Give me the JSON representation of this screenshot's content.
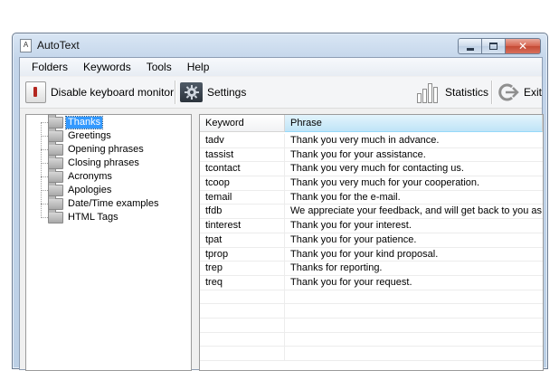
{
  "window": {
    "title": "AutoText",
    "icon_glyph": "A"
  },
  "caption_buttons": {
    "close_glyph": "✕"
  },
  "menu": [
    "Folders",
    "Keywords",
    "Tools",
    "Help"
  ],
  "toolbar": {
    "disable_monitor_label": "Disable keyboard monitor",
    "settings_label": "Settings",
    "statistics_label": "Statistics",
    "exit_label": "Exit"
  },
  "tree": {
    "selected": "Thanks",
    "folders": [
      "Thanks",
      "Greetings",
      "Opening phrases",
      "Closing phrases",
      "Acronyms",
      "Apologies",
      "Date/Time examples",
      "HTML Tags"
    ]
  },
  "list": {
    "columns": [
      "Keyword",
      "Phrase"
    ],
    "rows": [
      [
        "tadv",
        "Thank you very much in advance."
      ],
      [
        "tassist",
        "Thank you for your assistance."
      ],
      [
        "tcontact",
        "Thank you very much for contacting us."
      ],
      [
        "tcoop",
        "Thank you very much for your cooperation."
      ],
      [
        "temail",
        "Thank you for the e-mail."
      ],
      [
        "tfdb",
        "We appreciate your feedback, and will get back to you as soon a"
      ],
      [
        "tinterest",
        "Thank you for your interest."
      ],
      [
        "tpat",
        "Thank you for your patience."
      ],
      [
        "tprop",
        "Thank you for your kind proposal."
      ],
      [
        "trep",
        "Thanks for reporting."
      ],
      [
        "treq",
        "Thank you for your request."
      ]
    ]
  },
  "colors": {
    "selection": "#3399ff",
    "sorted_header": "#bfe4f7",
    "close_button": "#c44a35"
  }
}
